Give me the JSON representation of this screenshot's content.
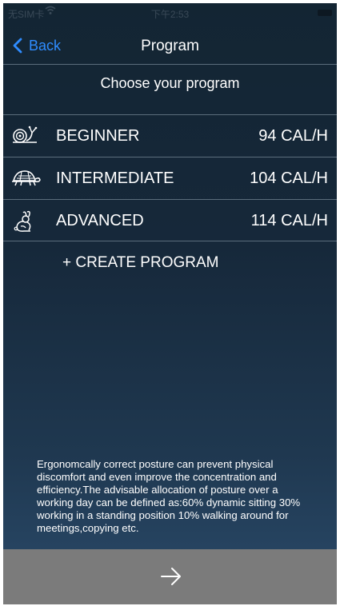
{
  "status_bar": {
    "carrier": "无SIM卡",
    "time": "下午2:53"
  },
  "nav": {
    "back_label": "Back",
    "title": "Program"
  },
  "subtitle": "Choose your program",
  "programs": [
    {
      "name": "BEGINNER",
      "calories": "94 CAL/H",
      "icon": "snail-icon"
    },
    {
      "name": "INTERMEDIATE",
      "calories": "104 CAL/H",
      "icon": "turtle-icon"
    },
    {
      "name": "ADVANCED",
      "calories": "114 CAL/H",
      "icon": "rabbit-icon"
    }
  ],
  "create_program_label": "+ CREATE PROGRAM",
  "info_text": "Ergonomcally correct posture can prevent physical discomfort and even improve the concentration and efficiency.The advisable allocation of posture over a working day can be defined as:60% dynamic sitting 30% working in a standing position 10% walking around for meetings,copying etc.",
  "next_button": {
    "icon": "arrow-right-icon"
  },
  "colors": {
    "accent": "#2f8cff",
    "background_top": "#132533",
    "background_bottom": "#2a4a6a",
    "divider": "#5b6d7c",
    "next_bar": "#7b7b7b",
    "text": "#ffffff"
  }
}
